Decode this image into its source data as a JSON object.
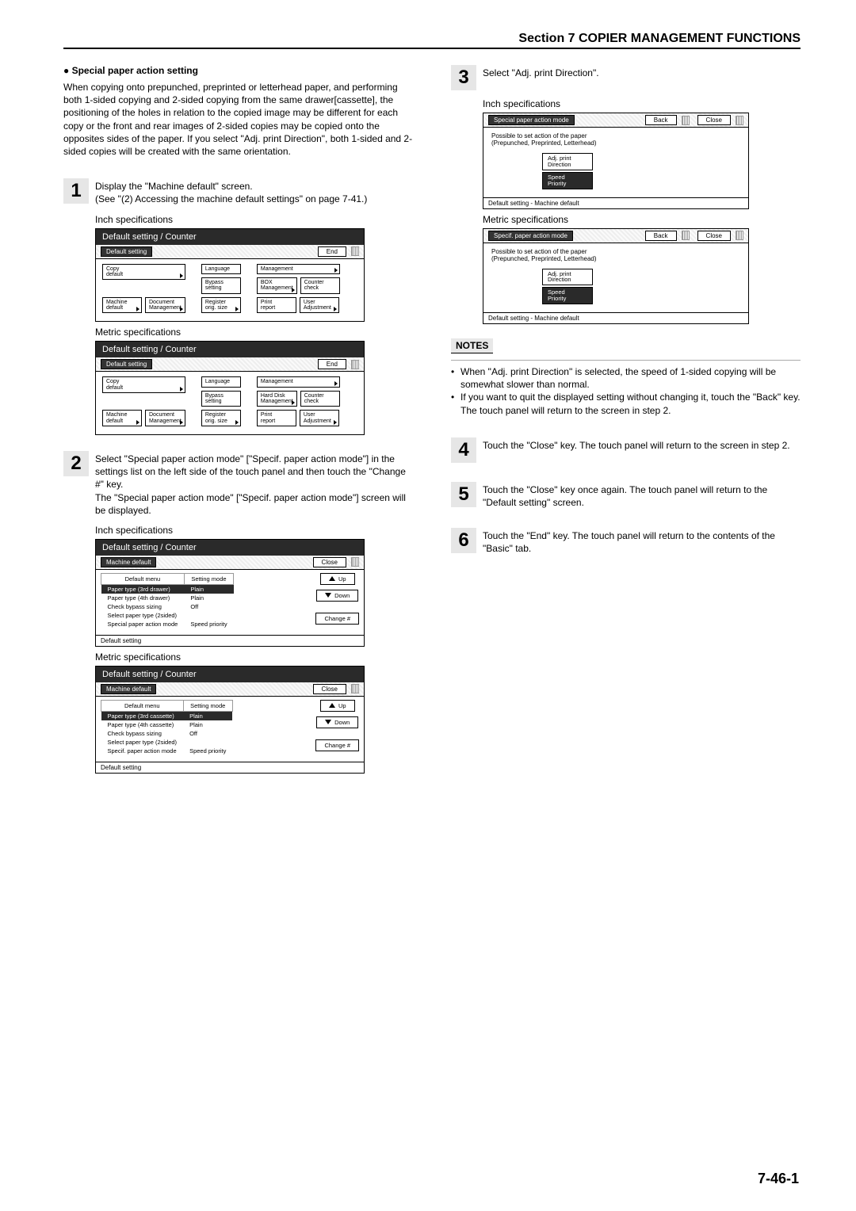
{
  "header": "Section 7  COPIER MANAGEMENT FUNCTIONS",
  "page_number": "7-46-1",
  "left": {
    "heading": "Special paper action setting",
    "intro": "When copying onto prepunched, preprinted or letterhead paper, and performing both 1-sided copying and 2-sided copying from the same drawer[cassette], the positioning of the holes in relation to the copied image may be different for each copy or the front and rear images of 2-sided copies may be copied onto the opposites sides of the paper. If you select \"Adj. print Direction\", both 1-sided and 2-sided copies will be created with the same orientation.",
    "step1_a": "Display the \"Machine default\" screen.",
    "step1_b": "(See \"(2) Accessing the machine default settings\" on page 7-41.)",
    "step2": "Select \"Special paper action mode\" [\"Specif. paper action mode\"] in the settings list on the left side of the touch panel and then touch the \"Change #\" key.\nThe \"Special paper action mode\" [\"Specif. paper action mode\"] screen will be displayed.",
    "inch_label": "Inch specifications",
    "metric_label": "Metric specifications",
    "panel_title": "Default setting / Counter",
    "strip_default": "Default setting",
    "strip_end": "End",
    "strip_machdef": "Machine default",
    "strip_close": "Close",
    "btns_inch": {
      "copy_default": "Copy\ndefault",
      "machine_default": "Machine\ndefault",
      "document_mgmt": "Document\nManagement",
      "language": "Language",
      "bypass_setting": "Bypass\nsetting",
      "register_orig": "Register\norig. size",
      "management": "Management",
      "box_mgmt": "BOX\nManagement",
      "print_report": "Print\nreport",
      "counter_check": "Counter\ncheck",
      "user_adj": "User\nAdjustment"
    },
    "btns_metric_diff": {
      "hd_mgmt": "Hard Disk\nManagement"
    },
    "md_headers": {
      "menu": "Default menu",
      "mode": "Setting mode"
    },
    "md_rows_inch": [
      {
        "menu": "Paper type (3rd drawer)",
        "mode": "Plain",
        "sel": true
      },
      {
        "menu": "Paper type (4th drawer)",
        "mode": "Plain"
      },
      {
        "menu": "Check bypass sizing",
        "mode": "Off"
      },
      {
        "menu": "Select paper type (2sided)",
        "mode": ""
      },
      {
        "menu": "Special paper action mode",
        "mode": "Speed priority"
      }
    ],
    "md_rows_metric": [
      {
        "menu": "Paper type (3rd cassette)",
        "mode": "Plain",
        "sel": true
      },
      {
        "menu": "Paper type (4th cassette)",
        "mode": "Plain"
      },
      {
        "menu": "Check bypass sizing",
        "mode": "Off"
      },
      {
        "menu": "Select paper type (2sided)",
        "mode": ""
      },
      {
        "menu": "Specif. paper action mode",
        "mode": "Speed priority"
      }
    ],
    "md_keys": {
      "up": "Up",
      "down": "Down",
      "change": "Change #"
    },
    "breadcrumb": "Default setting"
  },
  "right": {
    "step3": "Select \"Adj. print Direction\".",
    "step4": "Touch the \"Close\" key. The touch panel will return to the screen in step 2.",
    "step5": "Touch the \"Close\" key once again. The touch panel will return to the \"Default setting\" screen.",
    "step6": "Touch the \"End\" key. The touch panel will return to the contents of the \"Basic\" tab.",
    "inch_label": "Inch specifications",
    "metric_label": "Metric specifications",
    "rpanel_strip_inch": "Special paper action mode",
    "rpanel_strip_metric": "Specif. paper action mode",
    "rpanel_back": "Back",
    "rpanel_close": "Close",
    "rpanel_text": "Possible to set action of the paper\n(Prepunched, Preprinted, Letterhead)",
    "opt_adj": "Adj. print\nDirection",
    "opt_speed": "Speed\nPriority",
    "breadcrumb": "Default setting - Machine default",
    "notes_head": "NOTES",
    "notes": [
      "When \"Adj. print Direction\" is selected, the speed of 1-sided copying will be somewhat slower than normal.",
      "If you want to quit the displayed setting without changing it, touch the \"Back\" key. The touch panel will return to the screen in step 2."
    ]
  }
}
